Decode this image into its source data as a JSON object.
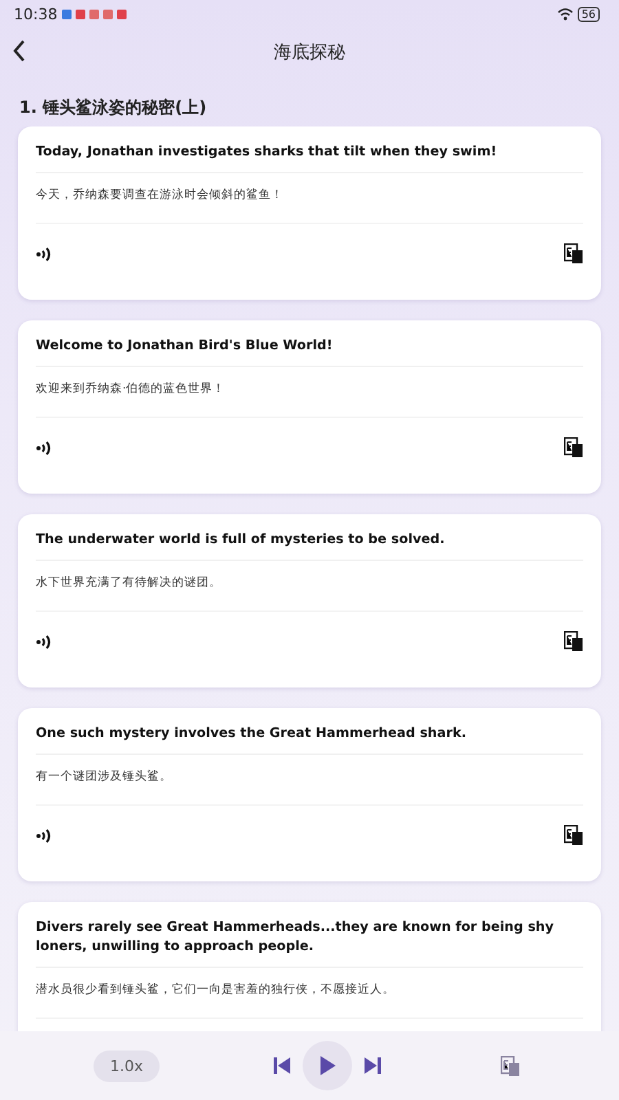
{
  "status_bar": {
    "time": "10:38",
    "battery": "56"
  },
  "header": {
    "title": "海底探秘"
  },
  "lesson_title": "1. 锤头鲨泳姿的秘密(上)",
  "sentences": [
    {
      "english": "Today, Jonathan investigates sharks that tilt when they swim!",
      "chinese": "今天，乔纳森要调查在游泳时会倾斜的鲨鱼！",
      "controls_visible": true
    },
    {
      "english": "Welcome to Jonathan Bird's Blue World!",
      "chinese": "欢迎来到乔纳森·伯德的蓝色世界！",
      "controls_visible": true
    },
    {
      "english": "The underwater world is full of mysteries to be solved.",
      "chinese": "水下世界充满了有待解决的谜团。",
      "controls_visible": true
    },
    {
      "english": "One such mystery involves the Great Hammerhead shark.",
      "chinese": "有一个谜团涉及锤头鲨。",
      "controls_visible": true
    },
    {
      "english": "Divers rarely see Great Hammerheads...they are known for being shy loners, unwilling to approach people.",
      "chinese": "潜水员很少看到锤头鲨，它们一向是害羞的独行侠，不愿接近人。",
      "controls_visible": false
    }
  ],
  "player": {
    "speed": "1.0x"
  }
}
